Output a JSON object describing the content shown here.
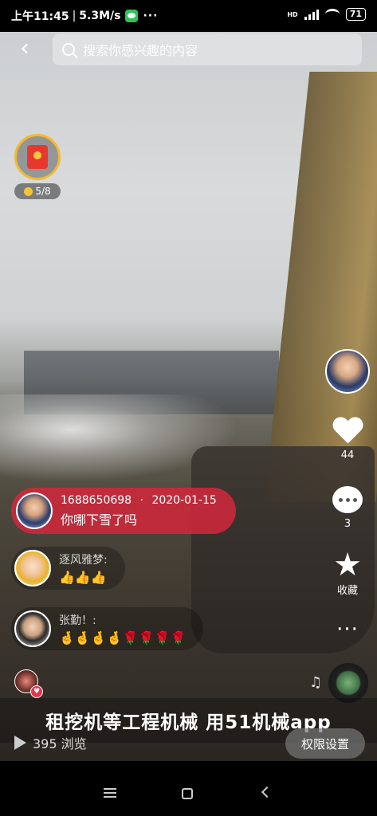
{
  "status_bar": {
    "time": "上午11:45",
    "speed": "5.3M/s",
    "more": "···",
    "network": "HD",
    "battery": "71"
  },
  "search": {
    "placeholder": "搜索你感兴趣的内容"
  },
  "reward": {
    "progress_text": "5/8"
  },
  "actions": {
    "like_count": "44",
    "comment_count": "3",
    "favorite_label": "收藏",
    "more": "···"
  },
  "comments": [
    {
      "user": "1688650698",
      "date": "2020-01-15",
      "separator": "·",
      "text": "你哪下雪了吗"
    },
    {
      "user": "逐风雅梦:",
      "text": "👍👍👍"
    },
    {
      "user": "张勤！:",
      "text": "🤞🤞🤞🤞🌹🌹🌹🌹"
    }
  ],
  "caption": "租挖机等工程机械 用51机械app",
  "views": "395 浏览",
  "permission_button": "权限设置",
  "icons": {
    "back": "back-arrow-icon",
    "search": "search-icon",
    "heart": "heart-icon",
    "comment": "comment-icon",
    "star": "star-icon",
    "more": "more-icon",
    "play": "play-icon",
    "music": "music-note-icon"
  },
  "colors": {
    "highlight_comment": "#d2283c",
    "reward_ring": "#f5b82e",
    "wechat_green": "#2fc25b"
  }
}
